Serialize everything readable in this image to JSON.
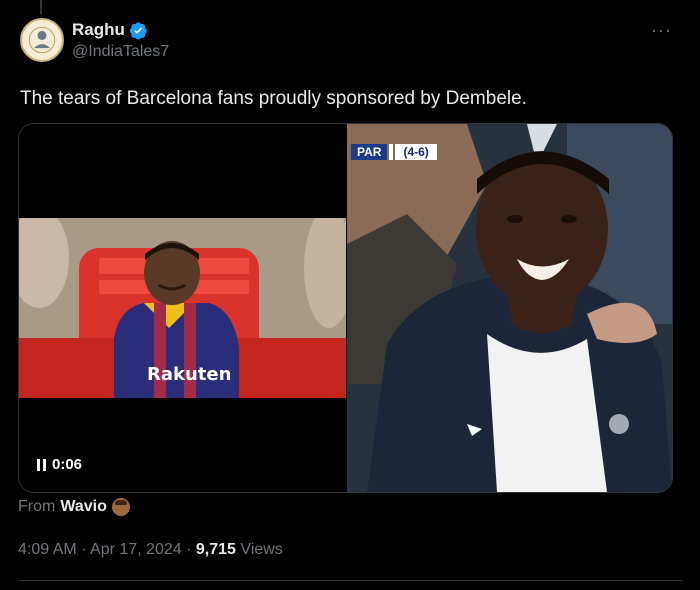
{
  "author": {
    "display_name": "Raghu",
    "handle": "@IndiaTales7",
    "verified": true,
    "verified_color": "#1d9bf0",
    "avatar_icon": "india-tales-logo"
  },
  "more_label": "···",
  "tweet": {
    "text": "The tears of Barcelona fans proudly sponsored by Dembele."
  },
  "media": {
    "score_team": "PAR",
    "score_value": "(4-6)",
    "playback_time": "0:06",
    "playback_icon": "pause-icon",
    "left_jersey_text": "Rakuten"
  },
  "source": {
    "prefix": "From",
    "name": "Wavio"
  },
  "meta": {
    "time": "4:09 AM",
    "sep1": " · ",
    "date": "Apr 17, 2024",
    "sep2": " · ",
    "views_count": "9,715",
    "views_label": " Views"
  }
}
